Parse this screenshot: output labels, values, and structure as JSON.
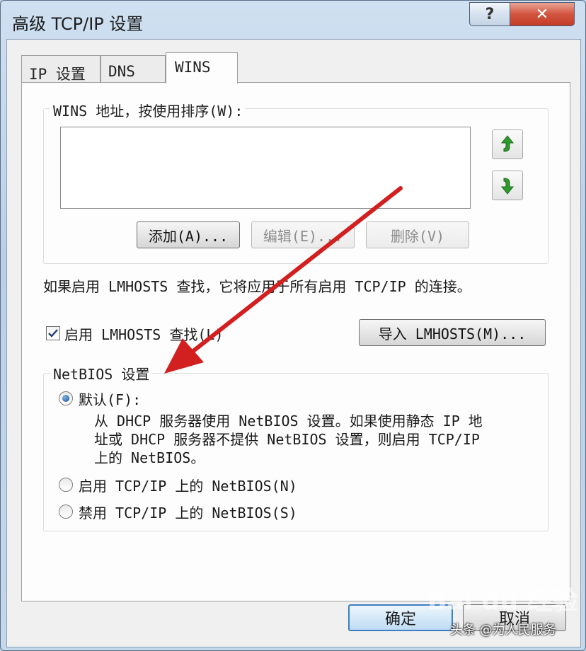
{
  "window": {
    "title": "高级 TCP/IP 设置",
    "help_glyph": "?",
    "close_glyph": "✕"
  },
  "tabs": [
    {
      "label": "IP 设置",
      "active": false
    },
    {
      "label": "DNS",
      "active": false
    },
    {
      "label": "WINS",
      "active": true
    }
  ],
  "wins": {
    "group_label": "WINS 地址，按使用排序(W):",
    "addresses": [],
    "move_up_icon": "up-arrow-icon",
    "move_down_icon": "down-arrow-icon",
    "add_label": "添加(A)...",
    "edit_label": "编辑(E)...",
    "delete_label": "删除(V)"
  },
  "lmhosts": {
    "info_text": "如果启用 LMHOSTS 查找，它将应用于所有启用 TCP/IP 的连接。",
    "enable_label": "启用 LMHOSTS 查找(L)",
    "enable_checked": true,
    "import_label": "导入 LMHOSTS(M)..."
  },
  "netbios": {
    "group_label": "NetBIOS 设置",
    "default_label": "默认(F):",
    "default_desc": [
      "从 DHCP 服务器使用 NetBIOS 设置。如果使用静态 IP 地",
      "址或 DHCP 服务器不提供 NetBIOS 设置，则启用 TCP/IP",
      "上的 NetBIOS。"
    ],
    "enable_label": "启用 TCP/IP 上的 NetBIOS(N)",
    "disable_label": "禁用 TCP/IP 上的 NetBIOS(S)",
    "selected": "default"
  },
  "footer": {
    "ok_label": "确定",
    "cancel_label": "取消"
  },
  "overlay": {
    "watermark": "Bai du 经验",
    "credit": "头条 @为人民服务",
    "arrow_color": "#d21f1f"
  },
  "colors": {
    "accent": "#2f6fb6",
    "arrow_green": "#2e9a2e"
  }
}
